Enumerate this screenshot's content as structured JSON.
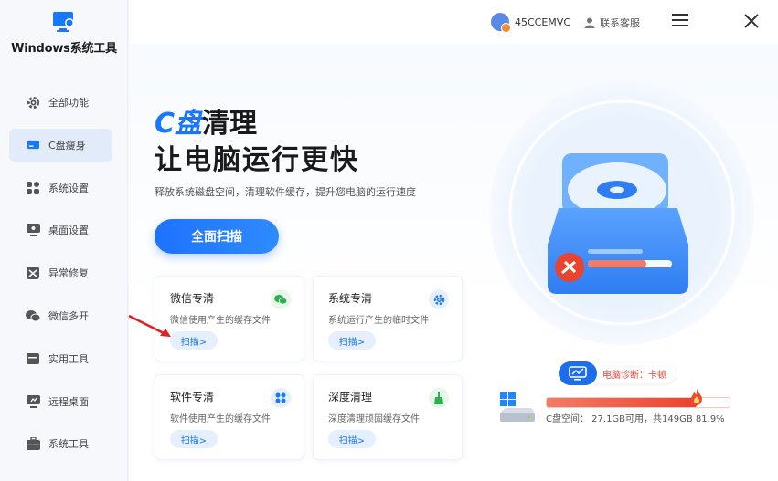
{
  "app": {
    "title": "Windows系统工具"
  },
  "sidebar": {
    "items": [
      {
        "label": "全部功能",
        "icon": "gear-icon"
      },
      {
        "label": "C盘瘦身",
        "icon": "drive-icon",
        "active": true
      },
      {
        "label": "系统设置",
        "icon": "grid-icon"
      },
      {
        "label": "桌面设置",
        "icon": "monitor-icon"
      },
      {
        "label": "异常修复",
        "icon": "repair-icon"
      },
      {
        "label": "微信多开",
        "icon": "wechat-icon"
      },
      {
        "label": "实用工具",
        "icon": "toolbox-icon"
      },
      {
        "label": "远程桌面",
        "icon": "remote-desktop-icon"
      },
      {
        "label": "系统工具",
        "icon": "briefcase-icon"
      }
    ]
  },
  "header": {
    "username": "45CCEMVC",
    "support": "联系客服"
  },
  "hero": {
    "title_accent": "C盘",
    "title_rest": "清理",
    "subtitle_line": "让电脑运行更快",
    "description": "释放系统磁盘空间，清理软件缓存，提升您电脑的运行速度",
    "scan_all": "全面扫描"
  },
  "cards": [
    {
      "title": "微信专清",
      "desc": "微信使用产生的缓存文件",
      "button": "扫描>",
      "icon": "wechat-icon",
      "color": "#2bb24c"
    },
    {
      "title": "系统专清",
      "desc": "系统运行产生的临时文件",
      "button": "扫描>",
      "icon": "gear-icon",
      "color": "#1677ff"
    },
    {
      "title": "软件专清",
      "desc": "软件使用产生的缓存文件",
      "button": "扫描>",
      "icon": "apps-icon",
      "color": "#1677ff"
    },
    {
      "title": "深度清理",
      "desc": "深度清理顽固缓存文件",
      "button": "扫描>",
      "icon": "broom-icon",
      "color": "#2bb24c"
    }
  ],
  "diagnosis": {
    "text": "电脑诊断：卡顿"
  },
  "disk": {
    "label": "C盘空间：  27.1GB可用，共149GB    81.9%",
    "used_fraction": 0.819
  },
  "colors": {
    "accent": "#1677ff",
    "warning": "#e8442f"
  }
}
